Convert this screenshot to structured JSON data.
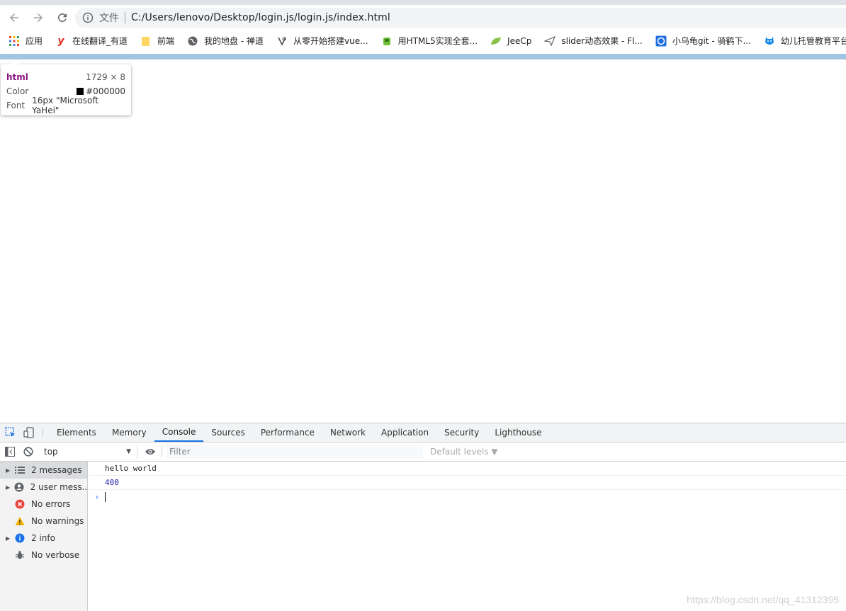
{
  "browser": {
    "address_scheme": "文件",
    "address_url": "C:/Users/lenovo/Desktop/login.js/login.js/index.html"
  },
  "bookmarks": [
    {
      "label": "应用",
      "icon": "apps-grid-icon"
    },
    {
      "label": "在线翻译_有道",
      "icon": "youdao-icon"
    },
    {
      "label": "前端",
      "icon": "folder-icon"
    },
    {
      "label": "我的地盘 - 禅道",
      "icon": "globe-icon"
    },
    {
      "label": "从零开始搭建vue...",
      "icon": "vue-icon"
    },
    {
      "label": "用HTML5实现全套...",
      "icon": "android-icon"
    },
    {
      "label": "JeeCp",
      "icon": "leaf-icon"
    },
    {
      "label": "slider动态效果 - Fl...",
      "icon": "paper-plane-icon"
    },
    {
      "label": "小乌龟git - 骑鹤下...",
      "icon": "csdn-icon"
    },
    {
      "label": "幼儿托管教育平台",
      "icon": "mascot-icon"
    }
  ],
  "tooltip": {
    "tag": "html",
    "dimensions": "1729 × 8",
    "color_label": "Color",
    "color_value": "#000000",
    "font_label": "Font",
    "font_value": "16px \"Microsoft YaHei\""
  },
  "devtools": {
    "tabs": [
      "Elements",
      "Memory",
      "Console",
      "Sources",
      "Performance",
      "Network",
      "Application",
      "Security",
      "Lighthouse"
    ],
    "active_tab": "Console",
    "context": "top",
    "filter_placeholder": "Filter",
    "levels_label": "Default levels ▼",
    "sidebar": [
      {
        "label": "2 messages",
        "icon": "list-icon",
        "expandable": true
      },
      {
        "label": "2 user mess...",
        "icon": "user-icon",
        "expandable": true
      },
      {
        "label": "No errors",
        "icon": "error-icon",
        "expandable": false
      },
      {
        "label": "No warnings",
        "icon": "warning-icon",
        "expandable": false
      },
      {
        "label": "2 info",
        "icon": "info-icon",
        "expandable": true
      },
      {
        "label": "No verbose",
        "icon": "bug-icon",
        "expandable": false
      }
    ],
    "console_lines": [
      {
        "text": "hello world",
        "type": "string"
      },
      {
        "text": "400",
        "type": "number"
      }
    ]
  },
  "watermark": "https://blog.csdn.net/qq_41312395",
  "colors": {
    "accent": "#1a73e8",
    "page_top_bar": "#a0c4e4",
    "tag_purple": "#881280",
    "number_blue": "#1a1aa6"
  }
}
